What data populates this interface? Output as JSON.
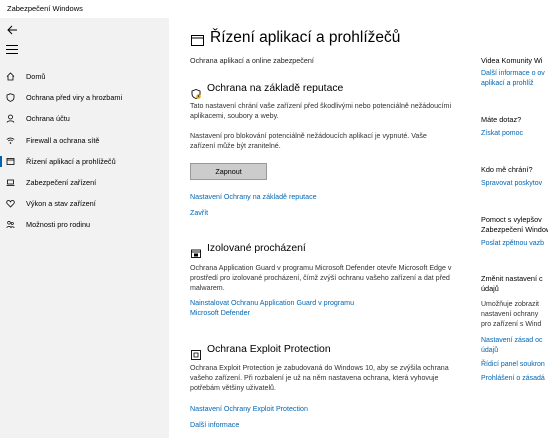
{
  "window": {
    "title": "Zabezpečení Windows"
  },
  "sidebar": {
    "items": [
      {
        "label": "Domů",
        "icon": "home-icon"
      },
      {
        "label": "Ochrana před viry a hrozbami",
        "icon": "shield-icon"
      },
      {
        "label": "Ochrana účtu",
        "icon": "person-icon"
      },
      {
        "label": "Firewall a ochrana sítě",
        "icon": "wifi-icon"
      },
      {
        "label": "Řízení aplikací a prohlížečů",
        "icon": "app-browser-icon"
      },
      {
        "label": "Zabezpečení zařízení",
        "icon": "laptop-icon"
      },
      {
        "label": "Výkon a stav zařízení",
        "icon": "heart-icon"
      },
      {
        "label": "Možnosti pro rodinu",
        "icon": "family-icon"
      }
    ]
  },
  "main": {
    "title": "Řízení aplikací a prohlížečů",
    "subtitle": "Ochrana aplikací a online zabezpečení",
    "reputation": {
      "title": "Ochrana na základě reputace",
      "text1": "Tato nastavení chrání vaše zařízení před škodlivými nebo potenciálně nežádoucími aplikacemi, soubory a weby.",
      "text2": "Nastavení pro blokování potenciálně nežádoucích aplikací je vypnuté. Vaše zařízení může být zranitelné.",
      "button": "Zapnout",
      "link_settings": "Nastavení Ochrany na základě reputace",
      "link_dismiss": "Zavřít"
    },
    "isolated": {
      "title": "Izolované procházení",
      "text": "Ochrana Application Guard v programu Microsoft Defender otevře Microsoft Edge v prostředí pro izolované procházení, čímž zvýší ochranu vašeho zařízení a dat před malwarem.",
      "link_line1": "Nainstalovat Ochranu Application Guard v programu",
      "link_line2": "Microsoft Defender"
    },
    "exploit": {
      "title": "Ochrana Exploit Protection",
      "text": "Ochrana Exploit Protection je zabudovaná do Windows 10, aby se zvýšila ochrana vašeho zařízení. Při rozbalení je už na něm nastavena ochrana, která vyhovuje potřebám většiny uživatelů.",
      "link_settings": "Nastavení Ochrany Exploit Protection",
      "link_more": "Další informace"
    }
  },
  "right": {
    "community": {
      "title": "Videa Komunity Wi",
      "link1": "Další informace o ov",
      "link2": "aplikací a prohlíž"
    },
    "question": {
      "title": "Máte dotaz?",
      "link": "Získat pomoc"
    },
    "protects": {
      "title": "Kdo mě chrání?",
      "link": "Spravovat poskytov"
    },
    "improve": {
      "title1": "Pomoct s vylepšov",
      "title2": "Zabezpečení Window",
      "link": "Poslat zpětnou vazb"
    },
    "privacy": {
      "title1": "Změnit nastavení c",
      "title2": "údajů",
      "text1": "Umožňuje zobrazit",
      "text2": "nastavení ochrany",
      "text3": "pro zařízení s Wind",
      "link1": "Nastavení zásad oc",
      "link1b": "údajů",
      "link2": "Řídicí panel soukron",
      "link3": "Prohlášení o zásadá"
    }
  },
  "colors": {
    "accent": "#0063b1",
    "link": "#0066b4",
    "sidebar_bg": "#f2f2f2"
  }
}
